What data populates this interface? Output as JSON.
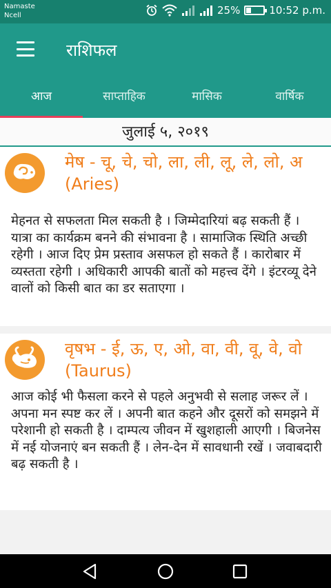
{
  "status": {
    "carrier_line1": "Namaste",
    "carrier_line2": "Ncell",
    "battery_text": "25%",
    "battery_level": 0.25,
    "time": "10:52 p.m."
  },
  "appbar": {
    "title": "राशिफल",
    "menu_icon": "hamburger-menu-icon"
  },
  "tabs": [
    {
      "label": "आज",
      "active": true
    },
    {
      "label": "साप्ताहिक",
      "active": false
    },
    {
      "label": "मासिक",
      "active": false
    },
    {
      "label": "वार्षिक",
      "active": false
    }
  ],
  "date": "जुलाई ५, २०१९",
  "cards": [
    {
      "icon": "aries-ram-icon",
      "title": "मेष - चू, चे, चो, ला,  ली, लू, ले, लो, अ (Aries)",
      "text": "मेहनत से सफलता मिल सकती है । जिम्मेदारियां बढ़ सकती हैं । यात्रा का कार्यक्रम बनने की संभावना है । सामाजिक स्थिति अच्छी रहेगी । आज दिए प्रेम प्रस्ताव असफल हो सकते हैं । कारोबार में व्यस्तता रहेगी । अधिकारी आपकी बातों को महत्त्व देंगे । इंटरव्यू देने वालों को किसी बात का डर सताएगा ।"
    },
    {
      "icon": "taurus-bull-icon",
      "title": "वृषभ - ई, ऊ, ए, ओ, वा, वी, वू, वे, वो (Taurus)",
      "text": "आज कोई भी फैसला करने से पहले अनुभवी से सलाह जरूर लें । अपना मन स्पष्ट कर लें । अपनी बात कहने और दूसरों को  समझने में परेशानी हो सकती है । दाम्पत्य जीवन में खुशहाली आएगी ।  बिजनेस में नई योजनाएं बन सकती हैं । लेन-देन में सावधानी रखें । जवाबदारी बढ़ सकती है ।"
    }
  ],
  "colors": {
    "primary": "#20998a",
    "status": "#17806e",
    "accent": "#e83e5a",
    "sign_orange": "#f07d1a"
  }
}
